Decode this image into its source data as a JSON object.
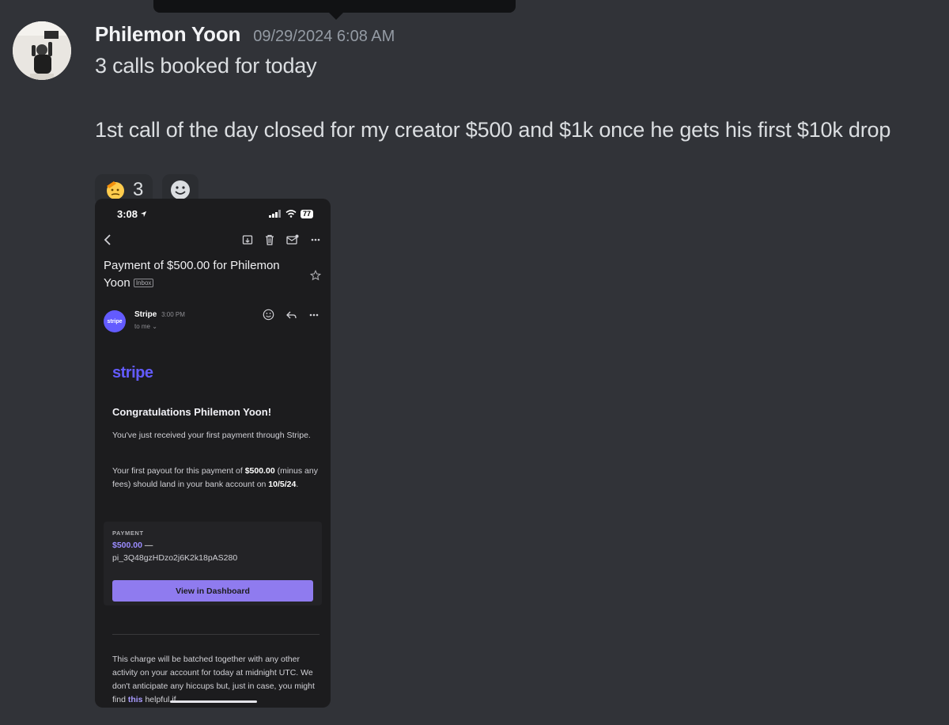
{
  "message": {
    "author": "Philemon Yoon",
    "timestamp": "09/29/2024 6:08 AM",
    "line1": "3 calls booked for today",
    "line2": "1st call of the day closed for my creator $500 and $1k once he gets his first $10k drop",
    "reactions": [
      {
        "emoji": "saluting-face",
        "count": "3"
      }
    ],
    "add_reaction_icon": "add-reaction-smiley"
  },
  "attachment": {
    "statusbar": {
      "time": "3:08",
      "battery": "77"
    },
    "subject_line1": "Payment of $500.00 for Philemon",
    "subject_line2": "Yoon",
    "inbox_tag": "Inbox",
    "sender": {
      "name": "Stripe",
      "time": "3:00 PM",
      "to": "to me",
      "avatar_text": "stripe"
    },
    "email": {
      "logo": "stripe",
      "heading": "Congratulations Philemon Yoon!",
      "para1": "You've just received your first payment through Stripe.",
      "para2_a": "Your first payout for this payment of ",
      "para2_amount": "$500.00",
      "para2_b": " (minus any fees) should land in your bank account on ",
      "para2_date": "10/5/24",
      "para2_c": ".",
      "payment_label": "PAYMENT",
      "payment_amount": "$500.00",
      "payment_dash": " —",
      "payment_id": "pi_3Q48gzHDzo2j6K2k18pAS280",
      "dashboard_button": "View in Dashboard",
      "para3_a": "This charge will be batched together with any other activity on your account for today at midnight UTC. We don't anticipate any hiccups but, just in case, you might find ",
      "para3_link": "this",
      "para3_b": " helpful if"
    }
  },
  "colors": {
    "background": "#313338",
    "stripe_purple": "#635bff",
    "button_purple": "#8f7bef"
  }
}
